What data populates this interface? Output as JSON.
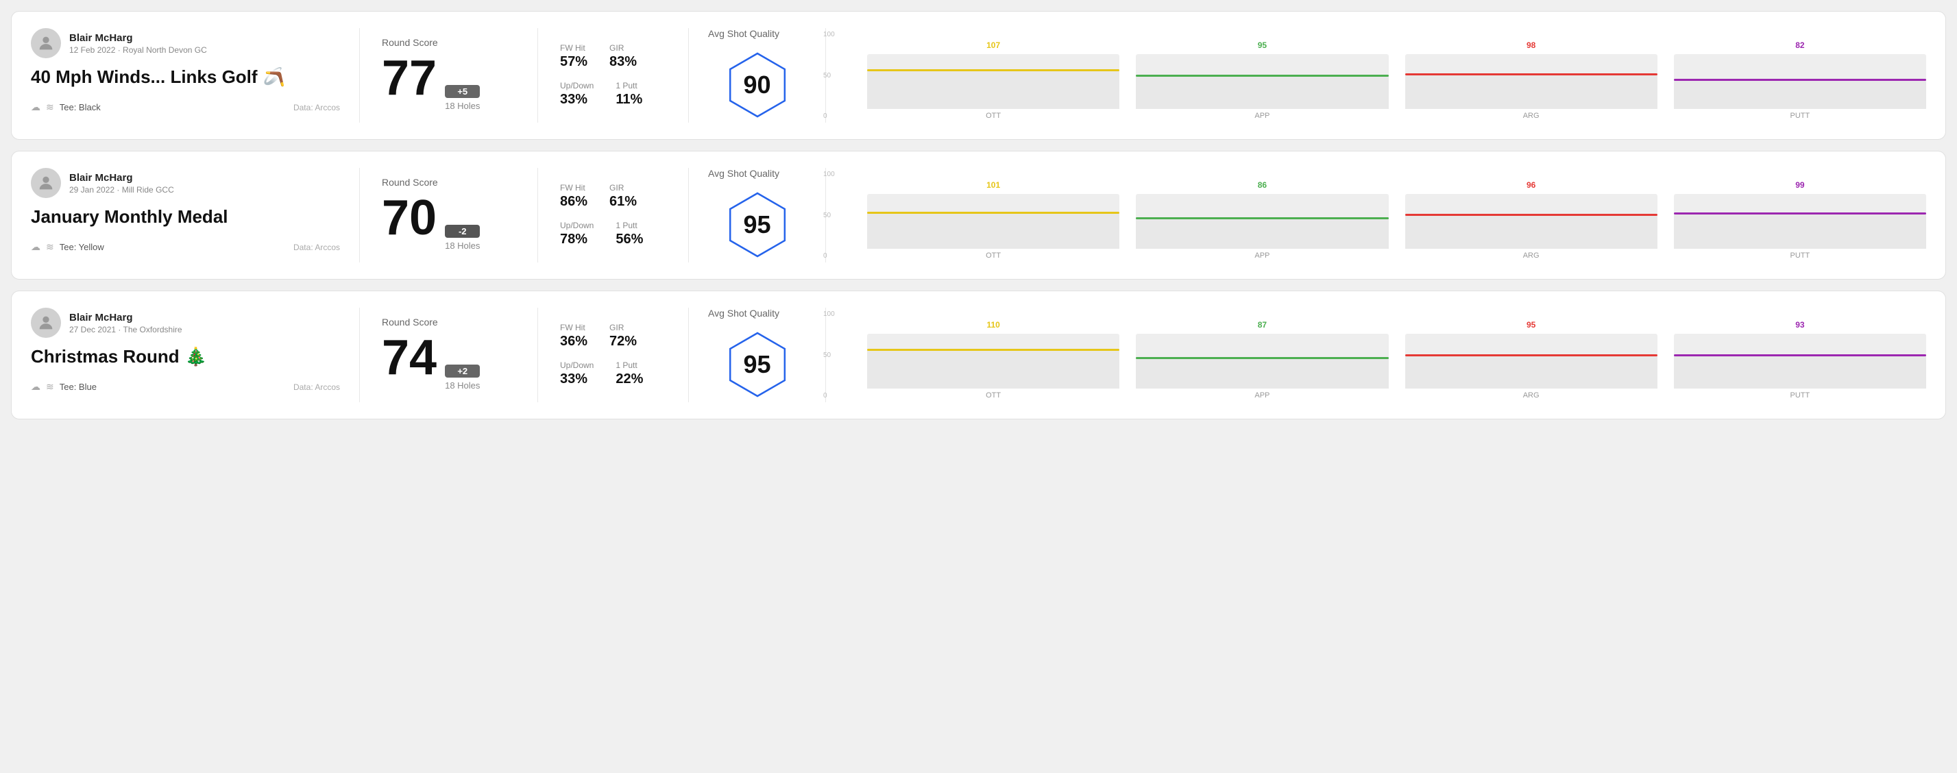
{
  "cards": [
    {
      "id": "card-1",
      "user": {
        "name": "Blair McHarg",
        "meta": "12 Feb 2022 · Royal North Devon GC"
      },
      "title": "40 Mph Winds... Links Golf",
      "title_emoji": "🪃",
      "tee": "Black",
      "data_source": "Data: Arccos",
      "round_score_label": "Round Score",
      "score": "77",
      "score_badge": "+5",
      "score_badge_type": "positive",
      "holes": "18 Holes",
      "fw_hit_label": "FW Hit",
      "fw_hit": "57%",
      "gir_label": "GIR",
      "gir": "83%",
      "updown_label": "Up/Down",
      "updown": "33%",
      "oneputt_label": "1 Putt",
      "oneputt": "11%",
      "avg_shot_quality_label": "Avg Shot Quality",
      "hex_score": "90",
      "chart": {
        "bars": [
          {
            "label": "OTT",
            "value": 107,
            "color": "#e6c619",
            "height_pct": 72
          },
          {
            "label": "APP",
            "value": 95,
            "color": "#4caf50",
            "height_pct": 63
          },
          {
            "label": "ARG",
            "value": 98,
            "color": "#e53935",
            "height_pct": 65
          },
          {
            "label": "PUTT",
            "value": 82,
            "color": "#9c27b0",
            "height_pct": 55
          }
        ]
      }
    },
    {
      "id": "card-2",
      "user": {
        "name": "Blair McHarg",
        "meta": "29 Jan 2022 · Mill Ride GCC"
      },
      "title": "January Monthly Medal",
      "title_emoji": "",
      "tee": "Yellow",
      "data_source": "Data: Arccos",
      "round_score_label": "Round Score",
      "score": "70",
      "score_badge": "-2",
      "score_badge_type": "negative",
      "holes": "18 Holes",
      "fw_hit_label": "FW Hit",
      "fw_hit": "86%",
      "gir_label": "GIR",
      "gir": "61%",
      "updown_label": "Up/Down",
      "updown": "78%",
      "oneputt_label": "1 Putt",
      "oneputt": "56%",
      "avg_shot_quality_label": "Avg Shot Quality",
      "hex_score": "95",
      "chart": {
        "bars": [
          {
            "label": "OTT",
            "value": 101,
            "color": "#e6c619",
            "height_pct": 67
          },
          {
            "label": "APP",
            "value": 86,
            "color": "#4caf50",
            "height_pct": 57
          },
          {
            "label": "ARG",
            "value": 96,
            "color": "#e53935",
            "height_pct": 64
          },
          {
            "label": "PUTT",
            "value": 99,
            "color": "#9c27b0",
            "height_pct": 66
          }
        ]
      }
    },
    {
      "id": "card-3",
      "user": {
        "name": "Blair McHarg",
        "meta": "27 Dec 2021 · The Oxfordshire"
      },
      "title": "Christmas Round",
      "title_emoji": "🎄",
      "tee": "Blue",
      "data_source": "Data: Arccos",
      "round_score_label": "Round Score",
      "score": "74",
      "score_badge": "+2",
      "score_badge_type": "positive",
      "holes": "18 Holes",
      "fw_hit_label": "FW Hit",
      "fw_hit": "36%",
      "gir_label": "GIR",
      "gir": "72%",
      "updown_label": "Up/Down",
      "updown": "33%",
      "oneputt_label": "1 Putt",
      "oneputt": "22%",
      "avg_shot_quality_label": "Avg Shot Quality",
      "hex_score": "95",
      "chart": {
        "bars": [
          {
            "label": "OTT",
            "value": 110,
            "color": "#e6c619",
            "height_pct": 73
          },
          {
            "label": "APP",
            "value": 87,
            "color": "#4caf50",
            "height_pct": 58
          },
          {
            "label": "ARG",
            "value": 95,
            "color": "#e53935",
            "height_pct": 63
          },
          {
            "label": "PUTT",
            "value": 93,
            "color": "#9c27b0",
            "height_pct": 62
          }
        ]
      }
    }
  ],
  "y_axis_labels": [
    "100",
    "50",
    "0"
  ]
}
